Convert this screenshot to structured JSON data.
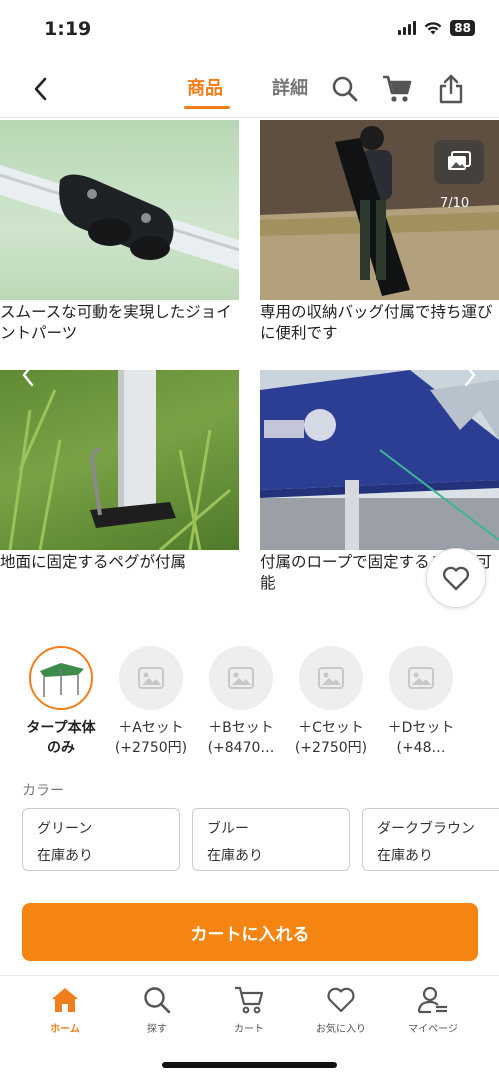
{
  "status_bar": {
    "time": "1:19",
    "battery": "88"
  },
  "nav": {
    "tab_products": "商品",
    "tab_details": "詳細"
  },
  "gallery": {
    "counter": "7/10",
    "captions": [
      "スムースな可動を実現したジョイントパーツ",
      "専用の収納バッグ付属で持ち運びに便利です",
      "地面に固定するペグが付属",
      "付属のロープで固定することも可能"
    ]
  },
  "variants": [
    {
      "line1": "タープ本体",
      "line2": "のみ",
      "selected": true
    },
    {
      "line1": "＋Aセット",
      "line2": "(+2750円)",
      "selected": false
    },
    {
      "line1": "＋Bセット",
      "line2": "(+8470…",
      "selected": false
    },
    {
      "line1": "＋Cセット",
      "line2": "(+2750円)",
      "selected": false
    },
    {
      "line1": "＋Dセット",
      "line2": "(+48…",
      "selected": false
    }
  ],
  "color_section": {
    "label": "カラー",
    "options": [
      {
        "name": "グリーン",
        "stock": "在庫あり"
      },
      {
        "name": "ブルー",
        "stock": "在庫あり"
      },
      {
        "name": "ダークブラウン",
        "stock": "在庫あり"
      }
    ]
  },
  "cart_button": "カートに入れる",
  "tab_bar": [
    {
      "label": "ホーム",
      "icon": "home-icon",
      "active": true
    },
    {
      "label": "探す",
      "icon": "search-icon",
      "active": false
    },
    {
      "label": "カート",
      "icon": "cart-icon",
      "active": false
    },
    {
      "label": "お気に入り",
      "icon": "heart-icon",
      "active": false
    },
    {
      "label": "マイページ",
      "icon": "user-icon",
      "active": false
    }
  ],
  "colors": {
    "accent": "#f58411",
    "accent_text": "#f07e1a"
  }
}
